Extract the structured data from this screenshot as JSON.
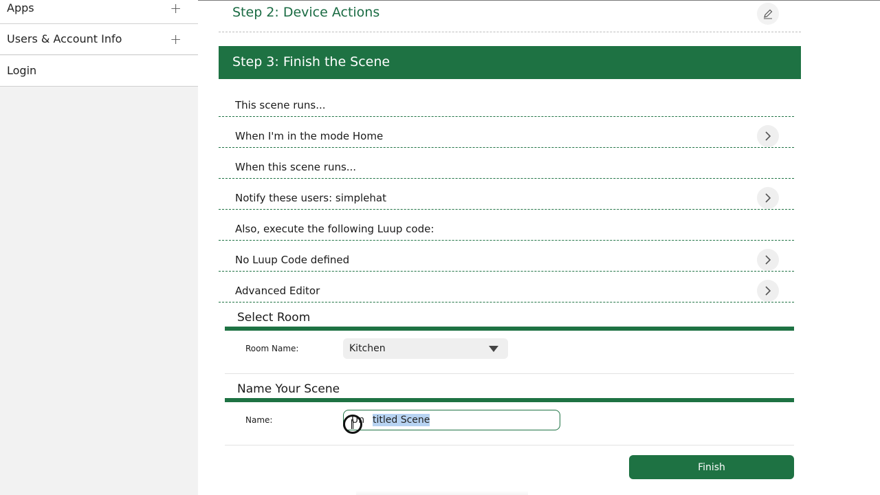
{
  "sidebar": {
    "items": [
      {
        "label": "Apps",
        "icon": "plus-icon"
      },
      {
        "label": "Users & Account Info",
        "icon": "plus-icon"
      },
      {
        "label": "Login"
      }
    ],
    "plus_glyph": "+"
  },
  "step2": {
    "title": "Step 2: Device Actions",
    "icon": "pencil-icon"
  },
  "step3": {
    "title": "Step 3: Finish the Scene"
  },
  "rows": [
    {
      "text": "This scene runs..."
    },
    {
      "text": "When I'm in the mode Home",
      "icon": "chevron-right-icon"
    },
    {
      "text": "When this scene runs..."
    },
    {
      "text": "Notify these users: simplehat",
      "icon": "chevron-right-icon"
    },
    {
      "text": "Also, execute the following Luup code:"
    },
    {
      "text": "No Luup Code defined",
      "icon": "chevron-right-icon"
    },
    {
      "text": "Advanced Editor",
      "icon": "chevron-right-icon"
    }
  ],
  "select_room": {
    "title": "Select Room",
    "label": "Room Name:",
    "value": "Kitchen",
    "icon": "caret-down-icon"
  },
  "name_scene": {
    "title": "Name Your Scene",
    "label": "Name:",
    "value_prefix": "Un",
    "value_selected": "titled Scene"
  },
  "finish": {
    "label": "Finish"
  },
  "colors": {
    "accent": "#1e7243",
    "selection": "#b7d3f2"
  }
}
